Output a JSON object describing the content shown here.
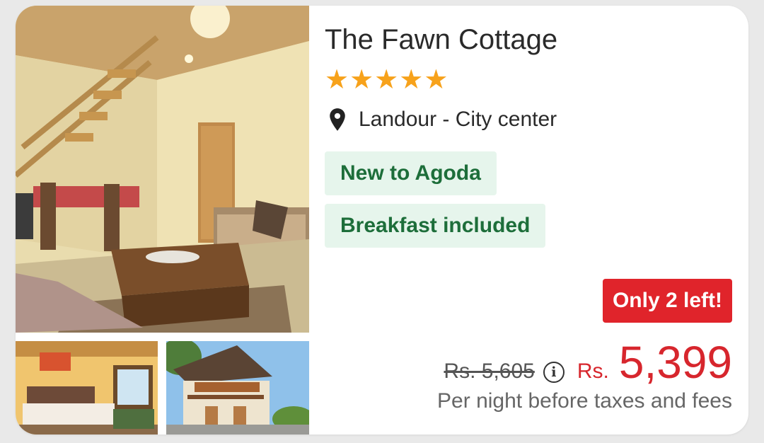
{
  "hotel": {
    "name": "The Fawn Cottage",
    "star_rating": 5,
    "star_icon": "★",
    "location": "Landour - City center",
    "badges": [
      "New to Agoda",
      "Breakfast included"
    ],
    "scarcity": "Only 2 left!",
    "original_price": "Rs. 5,605",
    "info_glyph": "i",
    "currency": "Rs.",
    "price": "5,399",
    "price_note": "Per night before taxes and fees"
  },
  "colors": {
    "star": "#f7a21b",
    "badge_bg": "#e6f5ec",
    "badge_text": "#1d6e3a",
    "scarcity_bg": "#e0242b",
    "price": "#d7262d"
  },
  "icons": {
    "location": "map-pin-icon",
    "price_info": "info-icon",
    "rating": "star-icon"
  }
}
